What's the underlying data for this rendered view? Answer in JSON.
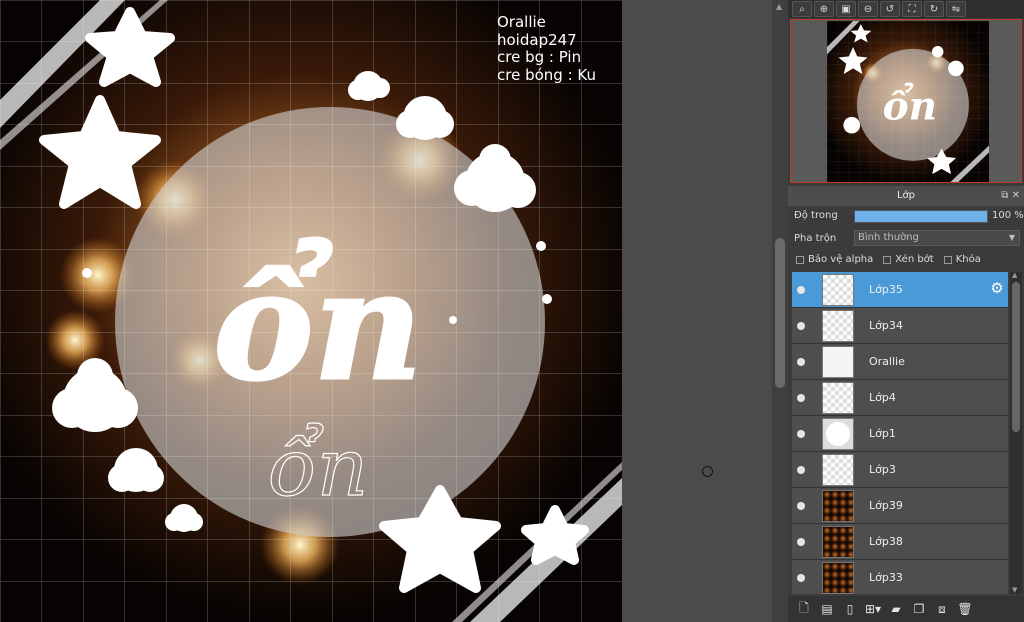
{
  "canvas": {
    "text_lines": [
      "Orallie",
      "hoidap247",
      "cre bg : Pin",
      "cre bóng : Ku"
    ],
    "big_word": "ổn",
    "small_word": "ổn"
  },
  "navigator_toolbar": {
    "icons": [
      "zoom-search-icon",
      "zoom-in-icon",
      "fit-screen-icon",
      "zoom-out-icon",
      "rotate-left-icon",
      "fullscreen-icon",
      "rotate-right-icon",
      "flip-icon"
    ]
  },
  "layer_panel": {
    "title": "Lớp",
    "opacity_label": "Độ trong",
    "opacity_value": "100 %",
    "opacity_fraction": 1.0,
    "blend_label": "Pha trộn",
    "blend_value": "Bình thường",
    "checkboxes": {
      "protect_alpha": "Bảo vệ alpha",
      "clipping": "Xén bớt",
      "lock": "Khóa"
    },
    "layers": [
      {
        "name": "Lớp35",
        "thumb": "transparent",
        "selected": true
      },
      {
        "name": "Lớp34",
        "thumb": "transparent",
        "selected": false
      },
      {
        "name": "Orallie",
        "thumb": "plain",
        "selected": false
      },
      {
        "name": "Lớp4",
        "thumb": "transparent",
        "selected": false
      },
      {
        "name": "Lớp1",
        "thumb": "circle",
        "selected": false
      },
      {
        "name": "Lớp3",
        "thumb": "transparent",
        "selected": false
      },
      {
        "name": "Lớp39",
        "thumb": "photo",
        "selected": false
      },
      {
        "name": "Lớp38",
        "thumb": "photo",
        "selected": false
      },
      {
        "name": "Lớp33",
        "thumb": "photo",
        "selected": false
      }
    ]
  },
  "colors": {
    "selected_layer": "#4a9ad8",
    "opacity_bar": "#6fb2ea",
    "panel_bg": "#3a3a3a"
  }
}
